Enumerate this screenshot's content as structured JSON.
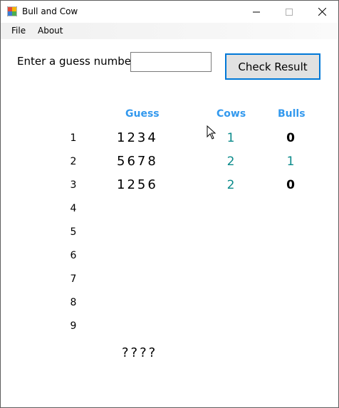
{
  "window": {
    "title": "Bull and Cow"
  },
  "menu": {
    "file": "File",
    "about": "About"
  },
  "form": {
    "prompt": "Enter a guess number:",
    "input_value": "",
    "check_button": "Check Result"
  },
  "table": {
    "headers": {
      "guess": "Guess",
      "cows": "Cows",
      "bulls": "Bulls"
    },
    "row_numbers": [
      "1",
      "2",
      "3",
      "4",
      "5",
      "6",
      "7",
      "8",
      "9"
    ],
    "rows": [
      {
        "guess": "1234",
        "cows": "1",
        "bulls": "0"
      },
      {
        "guess": "5678",
        "cows": "2",
        "bulls": "1"
      },
      {
        "guess": "1256",
        "cows": "2",
        "bulls": "0"
      }
    ],
    "secret": "????"
  },
  "colors": {
    "header": "#3399ee",
    "cows": "#0a8a8a",
    "bull_zero": "#000000",
    "bull_hit": "#0a8a8a",
    "accent": "#0078d7"
  },
  "icons": {
    "app": "app-icon",
    "minimize": "minimize-icon",
    "maximize": "maximize-icon",
    "close": "close-icon"
  }
}
